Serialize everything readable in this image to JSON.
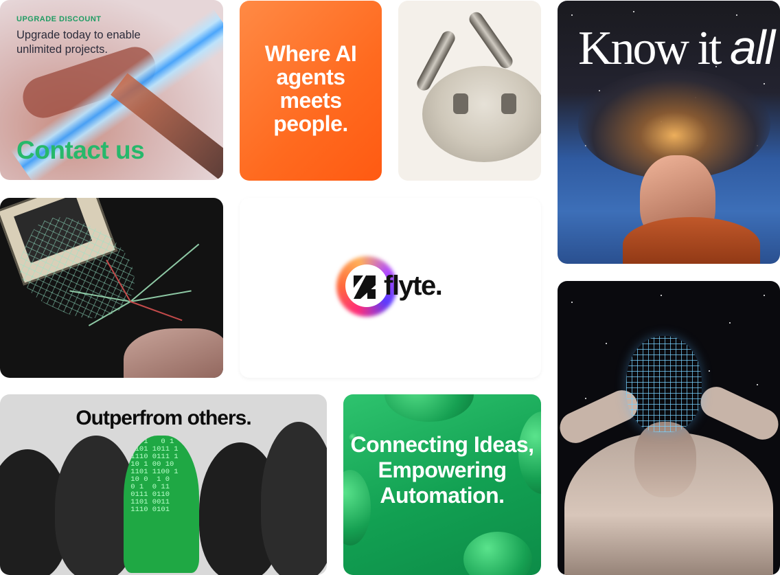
{
  "upgrade_card": {
    "kicker": "UPGRADE DISCOUNT",
    "headline": "Upgrade today to enable unlimited projects.",
    "cta": "Contact us"
  },
  "agents_card": {
    "text": "Where AI agents meets people."
  },
  "know_card": {
    "title_main": "Know it ",
    "title_em": "all"
  },
  "brand": {
    "wordmark": "flyte."
  },
  "outperform_card": {
    "title": "Outperfrom others."
  },
  "automation_card": {
    "text": "Connecting Ideas, Empowering Automation."
  },
  "colors": {
    "brand_green": "#27b86b",
    "orange": "#ff6a1f",
    "green_card": "#12a052"
  },
  "icons": [
    "flyte-logo-icon"
  ]
}
